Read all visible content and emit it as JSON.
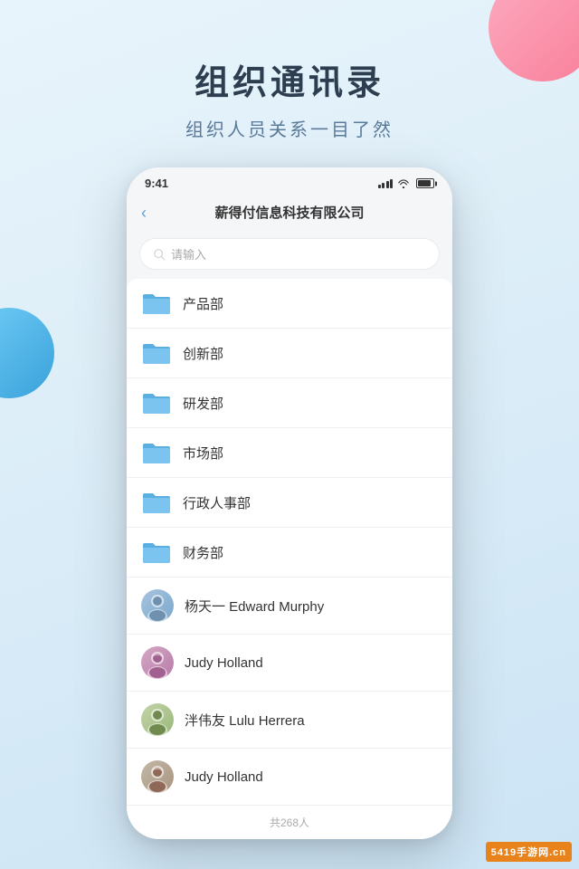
{
  "background": {
    "gradient_start": "#e8f4fb",
    "gradient_end": "#cce4f5"
  },
  "header": {
    "title": "组织通讯录",
    "subtitle": "组织人员关系一目了然"
  },
  "phone": {
    "status_bar": {
      "time": "9:41"
    },
    "nav": {
      "back_icon": "‹",
      "title": "薪得付信息科技有限公司"
    },
    "search": {
      "placeholder": "请输入"
    },
    "departments": [
      {
        "id": 1,
        "name": "产品部"
      },
      {
        "id": 2,
        "name": "创新部"
      },
      {
        "id": 3,
        "name": "研发部"
      },
      {
        "id": 4,
        "name": "市场部"
      },
      {
        "id": 5,
        "name": "行政人事部"
      },
      {
        "id": 6,
        "name": "财务部"
      }
    ],
    "contacts": [
      {
        "id": 1,
        "name": "杨天一  Edward Murphy",
        "avatar_type": "1"
      },
      {
        "id": 2,
        "name": "Judy Holland",
        "avatar_type": "2"
      },
      {
        "id": 3,
        "name": "泮伟友  Lulu Herrera",
        "avatar_type": "3"
      },
      {
        "id": 4,
        "name": "Judy Holland",
        "avatar_type": "4"
      }
    ],
    "footer": {
      "count_text": "共268人"
    }
  },
  "watermark": {
    "text": "5419手游网.cn"
  }
}
